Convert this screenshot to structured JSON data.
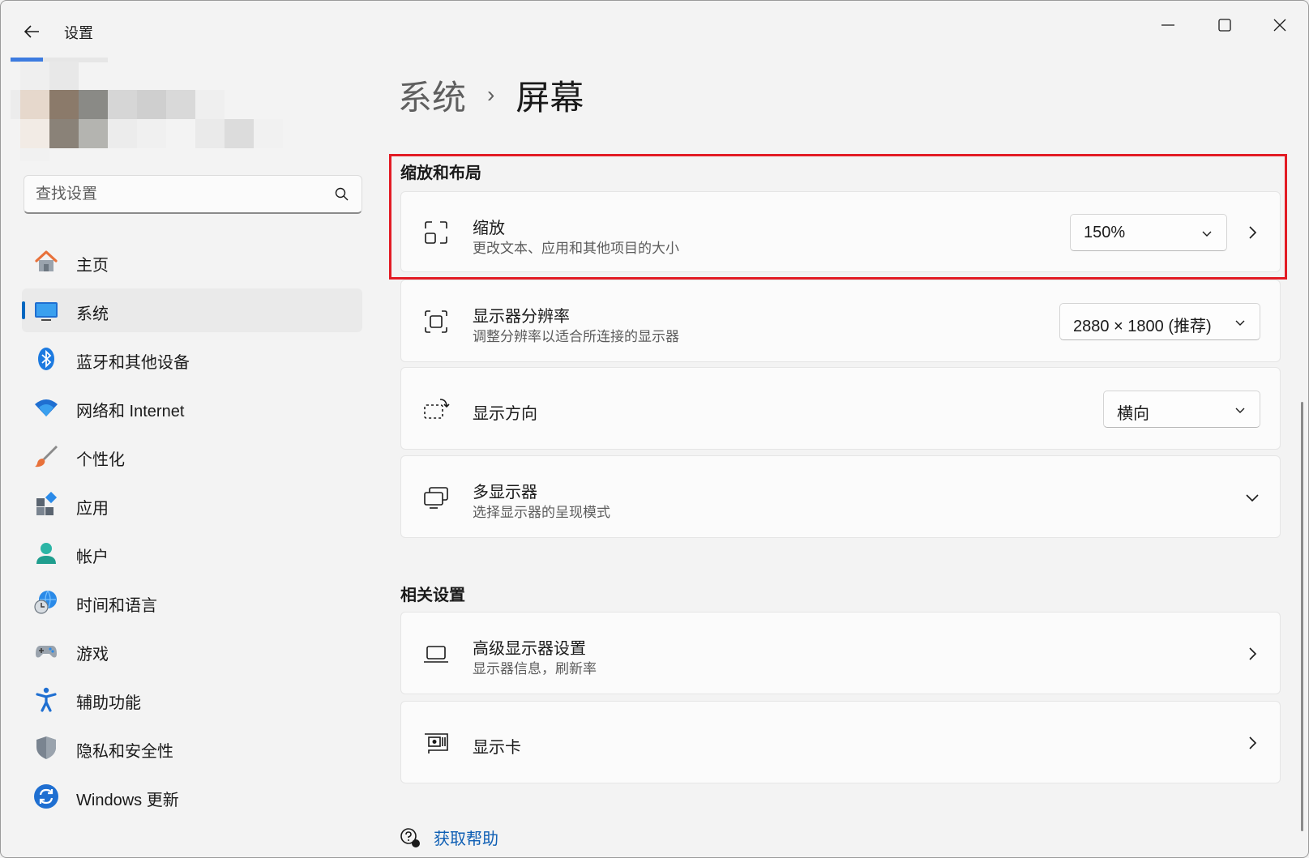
{
  "window": {
    "title": "设置",
    "accent_color": "#0067c0",
    "highlight_color": "#e21b24"
  },
  "search": {
    "placeholder": "查找设置",
    "value": ""
  },
  "sidebar": {
    "items": [
      {
        "label": "主页",
        "icon": "home-icon"
      },
      {
        "label": "系统",
        "icon": "system-display-icon",
        "active": true
      },
      {
        "label": "蓝牙和其他设备",
        "icon": "bluetooth-icon"
      },
      {
        "label": "网络和 Internet",
        "icon": "wifi-icon"
      },
      {
        "label": "个性化",
        "icon": "paintbrush-icon"
      },
      {
        "label": "应用",
        "icon": "apps-icon"
      },
      {
        "label": "帐户",
        "icon": "account-icon"
      },
      {
        "label": "时间和语言",
        "icon": "time-language-icon"
      },
      {
        "label": "游戏",
        "icon": "gamepad-icon"
      },
      {
        "label": "辅助功能",
        "icon": "accessibility-icon"
      },
      {
        "label": "隐私和安全性",
        "icon": "shield-icon"
      },
      {
        "label": "Windows 更新",
        "icon": "update-icon"
      }
    ]
  },
  "breadcrumb": {
    "parent": "系统",
    "separator": "›",
    "current": "屏幕"
  },
  "scale_layout": {
    "title": "缩放和布局",
    "scale": {
      "title": "缩放",
      "subtitle": "更改文本、应用和其他项目的大小",
      "value": "150%"
    },
    "resolution": {
      "title": "显示器分辨率",
      "subtitle": "调整分辨率以适合所连接的显示器",
      "value": "2880 × 1800 (推荐)"
    },
    "orientation": {
      "title": "显示方向",
      "value": "横向"
    },
    "multi_display": {
      "title": "多显示器",
      "subtitle": "选择显示器的呈现模式"
    }
  },
  "related": {
    "title": "相关设置",
    "advanced_display": {
      "title": "高级显示器设置",
      "subtitle": "显示器信息，刷新率"
    },
    "graphics": {
      "title": "显示卡"
    }
  },
  "help": {
    "label": "获取帮助"
  }
}
